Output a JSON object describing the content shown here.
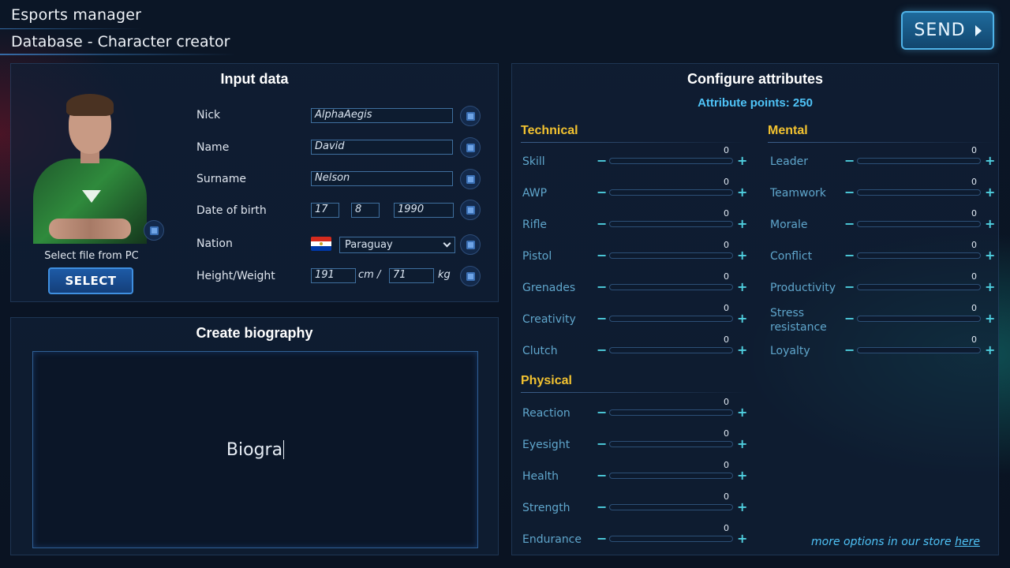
{
  "header": {
    "app_title": "Esports manager",
    "subtitle": "Database - Character creator",
    "send_label": "SEND"
  },
  "input_data": {
    "heading": "Input data",
    "select_caption": "Select file from PC",
    "select_label": "SELECT",
    "fields": {
      "nick": {
        "label": "Nick",
        "value": "AlphaAegis"
      },
      "name": {
        "label": "Name",
        "value": "David"
      },
      "surname": {
        "label": "Surname",
        "value": "Nelson"
      },
      "dob": {
        "label": "Date of birth",
        "day": "17",
        "month": "8",
        "year": "1990"
      },
      "nation": {
        "label": "Nation",
        "value": "Paraguay"
      },
      "height_weight": {
        "label": "Height/Weight",
        "height": "191",
        "height_unit": "cm /",
        "weight": "71",
        "weight_unit": "kg"
      }
    }
  },
  "biography": {
    "heading": "Create biography",
    "text": "Biogra"
  },
  "attributes": {
    "heading": "Configure attributes",
    "points_text": "Attribute points: 250",
    "groups": {
      "technical": {
        "title": "Technical",
        "items": [
          {
            "name": "Skill",
            "value": 0
          },
          {
            "name": "AWP",
            "value": 0
          },
          {
            "name": "Rifle",
            "value": 0
          },
          {
            "name": "Pistol",
            "value": 0
          },
          {
            "name": "Grenades",
            "value": 0
          },
          {
            "name": "Creativity",
            "value": 0
          },
          {
            "name": "Clutch",
            "value": 0
          }
        ]
      },
      "physical": {
        "title": "Physical",
        "items": [
          {
            "name": "Reaction",
            "value": 0
          },
          {
            "name": "Eyesight",
            "value": 0
          },
          {
            "name": "Health",
            "value": 0
          },
          {
            "name": "Strength",
            "value": 0
          },
          {
            "name": "Endurance",
            "value": 0
          }
        ]
      },
      "mental": {
        "title": "Mental",
        "items": [
          {
            "name": "Leader",
            "value": 0
          },
          {
            "name": "Teamwork",
            "value": 0
          },
          {
            "name": "Morale",
            "value": 0
          },
          {
            "name": "Conflict",
            "value": 0
          },
          {
            "name": "Productivity",
            "value": 0
          },
          {
            "name": "Stress resistance",
            "value": 0
          },
          {
            "name": "Loyalty",
            "value": 0
          }
        ]
      }
    },
    "max_value": 100,
    "minus_symbol": "−",
    "plus_symbol": "+",
    "store_note": "more options in our store",
    "store_link": "here"
  },
  "icons": {
    "randomize": "dice-icon",
    "send_arrow": "play-arrow-icon",
    "dropdown": "chevron-down-icon"
  },
  "colors": {
    "accent": "#4fc3f7",
    "group_title": "#f2c230",
    "attr_name": "#5fa6cc"
  }
}
